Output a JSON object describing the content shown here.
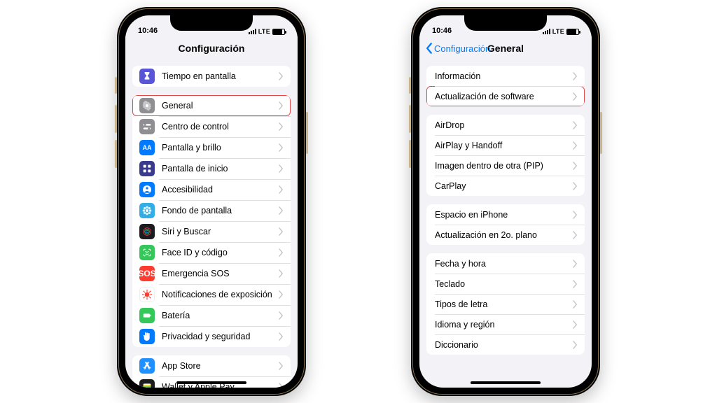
{
  "status": {
    "time": "10:46",
    "network": "LTE"
  },
  "phone1": {
    "header_title": "Configuración",
    "groups": [
      [
        {
          "id": "screen-time",
          "label": "Tiempo en pantalla",
          "icon": "hourglass-icon",
          "iconClass": "bg-hourglass"
        }
      ],
      [
        {
          "id": "general",
          "label": "General",
          "icon": "gear-icon",
          "iconClass": "bg-gear",
          "highlight": true
        },
        {
          "id": "control-center",
          "label": "Centro de control",
          "icon": "switches-icon",
          "iconClass": "bg-cc"
        },
        {
          "id": "display-brightness",
          "label": "Pantalla y brillo",
          "icon": "brightness-icon",
          "iconClass": "bg-brightness",
          "glyph": "AA"
        },
        {
          "id": "home-screen",
          "label": "Pantalla de inicio",
          "icon": "grid-icon",
          "iconClass": "bg-home"
        },
        {
          "id": "accessibility",
          "label": "Accesibilidad",
          "icon": "accessibility-icon",
          "iconClass": "bg-access"
        },
        {
          "id": "wallpaper",
          "label": "Fondo de pantalla",
          "icon": "flower-icon",
          "iconClass": "bg-wallpaper"
        },
        {
          "id": "siri-search",
          "label": "Siri y Buscar",
          "icon": "siri-icon",
          "iconClass": "bg-siri"
        },
        {
          "id": "faceid-passcode",
          "label": "Face ID y código",
          "icon": "faceid-icon",
          "iconClass": "bg-faceid"
        },
        {
          "id": "emergency-sos",
          "label": "Emergencia SOS",
          "icon": "sos-icon",
          "iconClass": "bg-sos",
          "glyph": "SOS"
        },
        {
          "id": "exposure-notifications",
          "label": "Notificaciones de exposición",
          "icon": "virus-icon",
          "iconClass": "bg-exposure"
        },
        {
          "id": "battery",
          "label": "Batería",
          "icon": "battery-icon",
          "iconClass": "bg-battery"
        },
        {
          "id": "privacy-security",
          "label": "Privacidad y seguridad",
          "icon": "hand-icon",
          "iconClass": "bg-privacy"
        }
      ],
      [
        {
          "id": "app-store",
          "label": "App Store",
          "icon": "appstore-icon",
          "iconClass": "bg-appstore"
        },
        {
          "id": "wallet",
          "label": "Wallet y Apple Pay",
          "icon": "wallet-icon",
          "iconClass": "bg-wallet"
        }
      ]
    ]
  },
  "phone2": {
    "back_label": "Configuración",
    "header_title": "General",
    "groups": [
      [
        {
          "id": "about",
          "label": "Información"
        },
        {
          "id": "software-update",
          "label": "Actualización de software",
          "highlight": true
        }
      ],
      [
        {
          "id": "airdrop",
          "label": "AirDrop"
        },
        {
          "id": "airplay-handoff",
          "label": "AirPlay y Handoff"
        },
        {
          "id": "pip",
          "label": "Imagen dentro de otra (PIP)"
        },
        {
          "id": "carplay",
          "label": "CarPlay"
        }
      ],
      [
        {
          "id": "iphone-storage",
          "label": "Espacio en iPhone"
        },
        {
          "id": "background-refresh",
          "label": "Actualización en 2o. plano"
        }
      ],
      [
        {
          "id": "date-time",
          "label": "Fecha y hora"
        },
        {
          "id": "keyboard",
          "label": "Teclado"
        },
        {
          "id": "fonts",
          "label": "Tipos de letra"
        },
        {
          "id": "language-region",
          "label": "Idioma y región"
        },
        {
          "id": "dictionary",
          "label": "Diccionario"
        }
      ]
    ]
  }
}
